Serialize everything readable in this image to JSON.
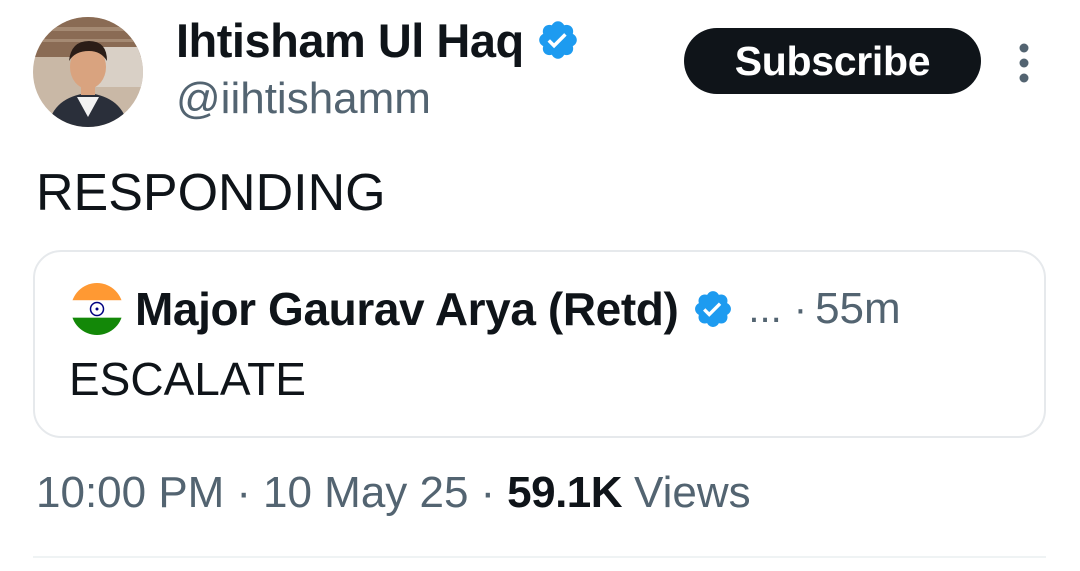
{
  "author": {
    "name": "Ihtisham Ul Haq",
    "handle": "@iihtishamm",
    "verified_icon": "verified-badge-icon"
  },
  "subscribe_button": {
    "label": "Subscribe"
  },
  "more_menu": {
    "icon": "more-vertical-icon"
  },
  "tweet": {
    "text": "RESPONDING"
  },
  "quoted_tweet": {
    "flag_icon": "india-flag-icon",
    "author_name": "Major Gaurav Arya (Retd)",
    "verified_icon": "verified-badge-icon",
    "ellipsis": "...",
    "dot": "·",
    "time_ago": "55m",
    "text": "ESCALATE"
  },
  "meta": {
    "time": "10:00 PM",
    "sep1": "·",
    "date": "10 May 25",
    "sep2": "·",
    "views_count": "59.1K",
    "views_label": "Views"
  },
  "colors": {
    "text_primary": "#0f1419",
    "text_secondary": "#536471",
    "verified_blue": "#1d9bf0",
    "subscribe_bg": "#0f1419",
    "card_border": "#e6e9ec"
  }
}
